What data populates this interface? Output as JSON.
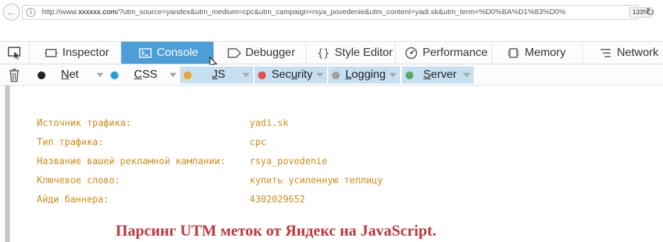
{
  "browser": {
    "url_prefix": "http://www.",
    "url_host": "xxxxxx.com",
    "url_rest": "/?utm_source=yandex&utm_medium=cpc&utm_campaign=rsya_povedenie&utm_content=yadi.sk&utm_term=%D0%BA%D1%83%D0%",
    "zoom": "133%"
  },
  "devtools": {
    "tabs": [
      {
        "label": "Inspector",
        "icon": "inspector-icon"
      },
      {
        "label": "Console",
        "icon": "console-icon"
      },
      {
        "label": "Debugger",
        "icon": "debugger-icon"
      },
      {
        "label": "Style Editor",
        "icon": "style-editor-icon"
      },
      {
        "label": "Performance",
        "icon": "performance-icon"
      },
      {
        "label": "Memory",
        "icon": "memory-icon"
      },
      {
        "label": "Network",
        "icon": "network-icon"
      }
    ],
    "selected_tab": "Console",
    "filters": [
      {
        "label": "Net",
        "underline": "N",
        "color": "#222222",
        "active": false
      },
      {
        "label": "CSS",
        "underline": "C",
        "color": "#1ea3d8",
        "active": false
      },
      {
        "label": "JS",
        "underline": "J",
        "color": "#f3a22c",
        "active": true
      },
      {
        "label": "Security",
        "underline": "u",
        "color": "#e84a4a",
        "active": true
      },
      {
        "label": "Logging",
        "underline": "L",
        "color": "#a0a0a0",
        "active": true
      },
      {
        "label": "Server",
        "underline": "S",
        "color": "#5aa86a",
        "active": true
      }
    ]
  },
  "console": {
    "lines": [
      {
        "key": "Источник трафика:",
        "value": "yadi.sk"
      },
      {
        "key": "Тип трафика:",
        "value": "cpc"
      },
      {
        "key": "Название вашей рекламной кампании:",
        "value": "rsya_povedenie"
      },
      {
        "key": "Ключевое слово:",
        "value": "купить усиленную теплицу"
      },
      {
        "key": "Айди баннера:",
        "value": "4302029652"
      }
    ],
    "text_color": "#d08b14"
  },
  "caption": "Парсинг UTM меток от Яндекс на JavaScript."
}
